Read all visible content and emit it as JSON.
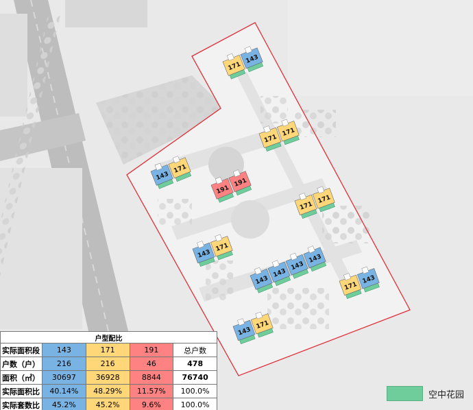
{
  "colors": {
    "unit_143": "#79b3e3",
    "unit_171": "#ffd779",
    "unit_191": "#ff8282",
    "sky_garden": "#6fcc9b",
    "site_boundary": "#e0303a"
  },
  "buildings": [
    {
      "id": "b1",
      "units": [
        "171",
        "143"
      ]
    },
    {
      "id": "b2",
      "units": [
        "171",
        "171"
      ]
    },
    {
      "id": "b3",
      "units": [
        "143",
        "171"
      ]
    },
    {
      "id": "b4",
      "units": [
        "191",
        "191"
      ]
    },
    {
      "id": "b5",
      "units": [
        "171",
        "171"
      ]
    },
    {
      "id": "b6",
      "units": [
        "143",
        "171"
      ]
    },
    {
      "id": "b7",
      "units": [
        "143",
        "143",
        "143",
        "143"
      ]
    },
    {
      "id": "b8",
      "units": [
        "171",
        "143"
      ]
    },
    {
      "id": "b9",
      "units": [
        "143",
        "171"
      ]
    }
  ],
  "table": {
    "title": "户型配比",
    "rows": [
      {
        "label": "实际面积段",
        "c143": "143",
        "c171": "171",
        "c191": "191",
        "total": "总户数"
      },
      {
        "label": "户数（户）",
        "c143": "216",
        "c171": "216",
        "c191": "46",
        "total": "478"
      },
      {
        "label": "面积（㎡）",
        "c143": "30697",
        "c171": "36928",
        "c191": "8844",
        "total": "76740"
      },
      {
        "label": "实际面积比",
        "c143": "40.14%",
        "c171": "48.29%",
        "c191": "11.57%",
        "total": "100.0%"
      },
      {
        "label": "实际套数比",
        "c143": "45.2%",
        "c171": "45.2%",
        "c191": "9.6%",
        "total": "100.0%"
      }
    ]
  },
  "legend": {
    "sky_garden_label": "空中花园"
  }
}
